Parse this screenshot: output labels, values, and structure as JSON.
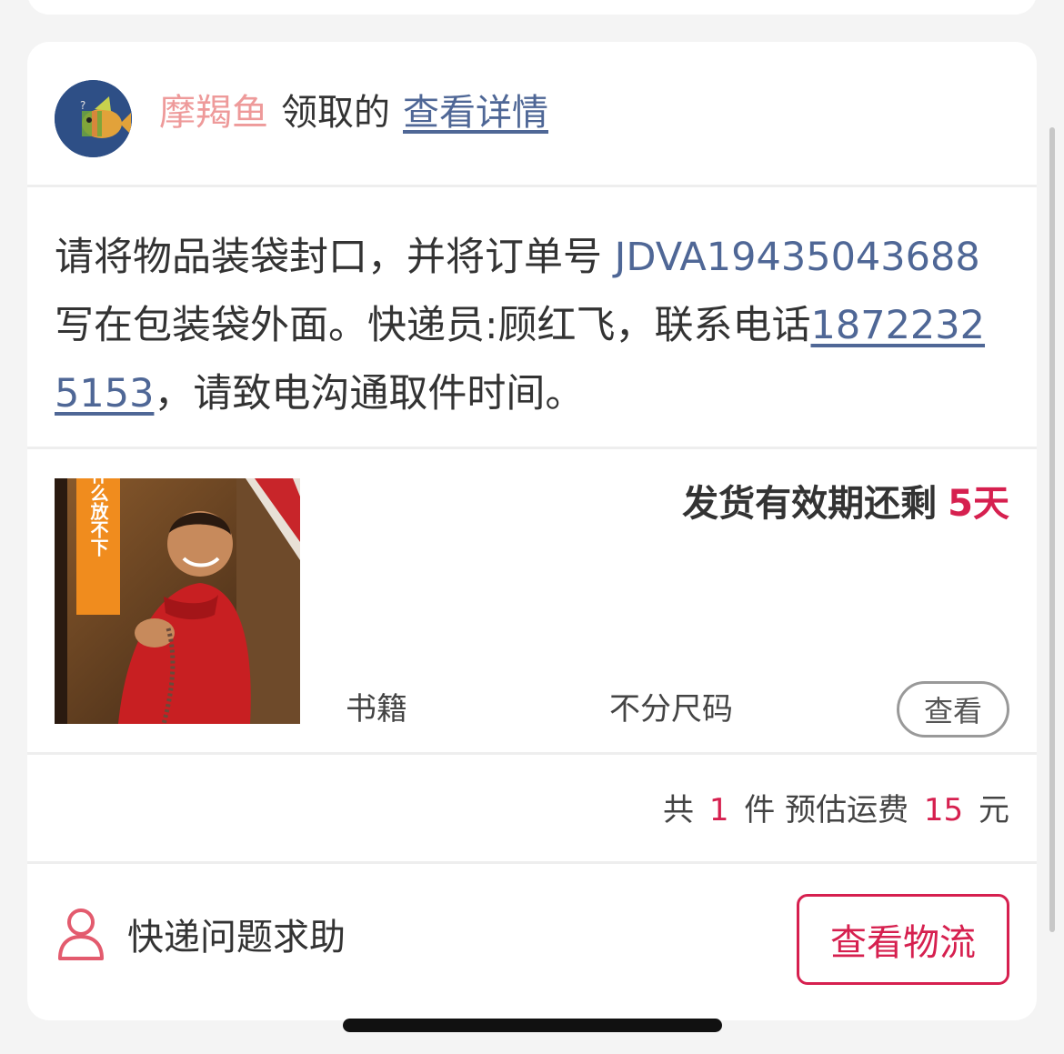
{
  "colors": {
    "accent": "#d6204f",
    "link": "#4f6796",
    "claimer": "#ee9a9a"
  },
  "header": {
    "avatar_icon": "fish-avatar-icon",
    "claimer_name": "摩羯鱼",
    "claim_verb": "领取的",
    "detail_link": "查看详情"
  },
  "instructions": {
    "text_before_order": "请将物品装袋封口，并将订单号 ",
    "order_number": "JDVA19435043688",
    "text_after_order": " 写在包装袋外面。快递员:顾红飞，联系电话",
    "phone": "18722325153",
    "text_after_phone": "，请致电沟通取件时间。"
  },
  "item": {
    "cover_icon": "book-cover-image",
    "cover_title": "没什么放不下",
    "validity_label": "发货有效期还剩",
    "validity_days": "5天",
    "category": "书籍",
    "size": "不分尺码",
    "view_button": "查看"
  },
  "summary": {
    "prefix": "共",
    "count": "1",
    "count_unit": "件 预估运费",
    "shipping_fee": "15",
    "fee_unit": "元"
  },
  "footer": {
    "help_icon": "person-icon",
    "help_label": "快递问题求助",
    "track_button": "查看物流"
  }
}
